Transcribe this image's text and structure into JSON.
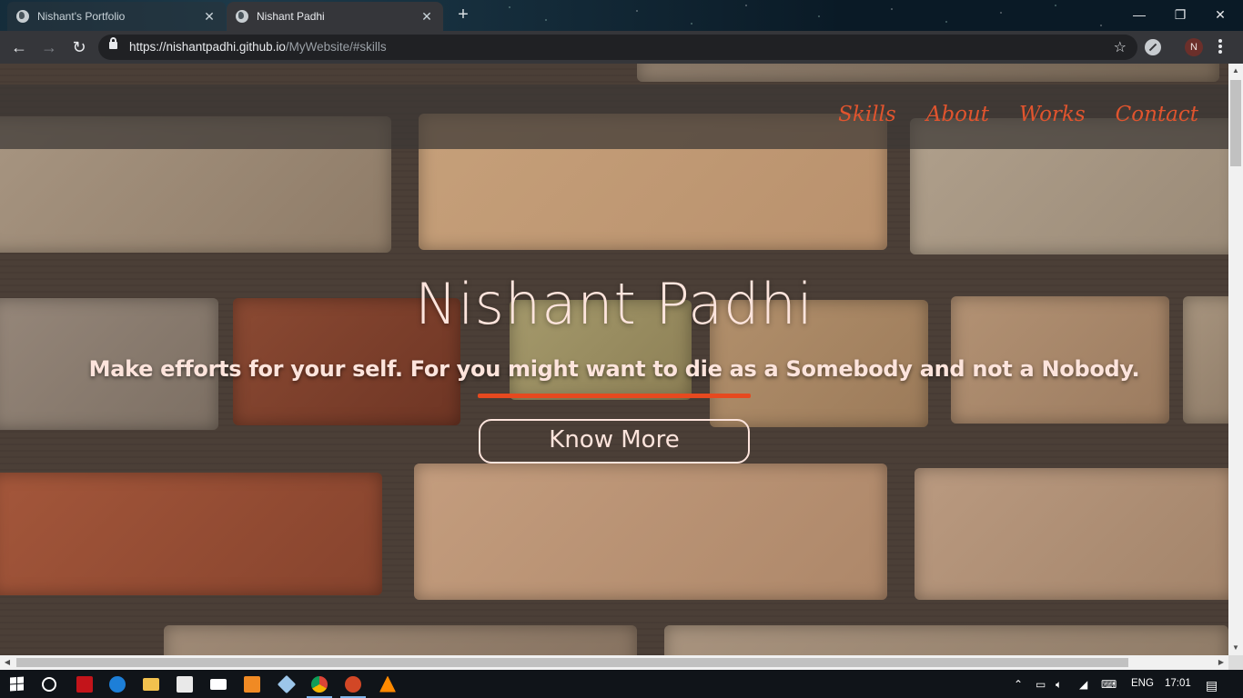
{
  "browser": {
    "tabs": [
      {
        "title": "Nishant's Portfolio",
        "active": false
      },
      {
        "title": "Nishant Padhi",
        "active": true
      }
    ],
    "new_tab": "+",
    "window_controls": {
      "minimize": "—",
      "restore": "❐",
      "close": "✕"
    },
    "url": {
      "host": "https://nishantpadhi.github.io",
      "path": "/MyWebsite/#skills"
    },
    "profile_initial": "N"
  },
  "site": {
    "nav": [
      "Skills",
      "About",
      "Works",
      "Contact"
    ],
    "nav_color": "#e0542e",
    "title": "Nishant Padhi",
    "tagline": "Make efforts for your self. For you might want to die as a Somebody and not a Nobody.",
    "cta": "Know More",
    "accent": "#e6491f",
    "text_color": "#fde4dc"
  },
  "taskbar": {
    "apps": [
      "start-icon",
      "cortana-icon",
      "acrobat-icon",
      "edge-icon",
      "file-explorer-icon",
      "store-icon",
      "mail-icon",
      "sublime-icon",
      "app-icon",
      "chrome-icon",
      "powerpoint-icon",
      "vlc-icon"
    ],
    "language": "ENG",
    "time": "17:01"
  }
}
